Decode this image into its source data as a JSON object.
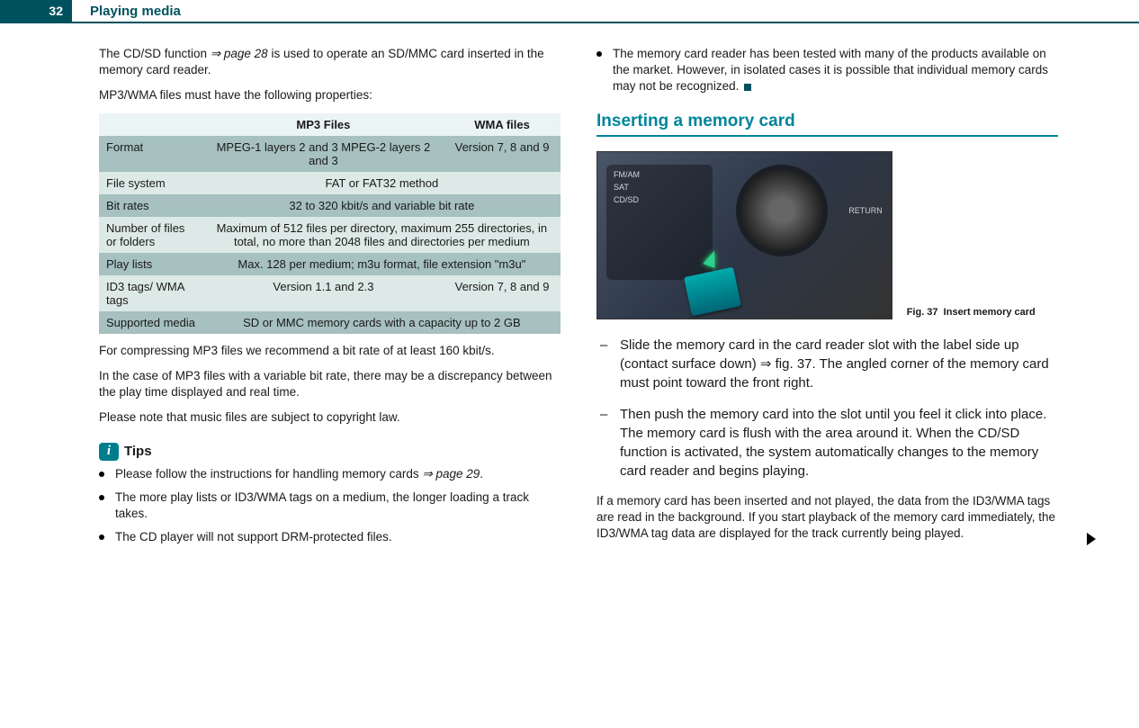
{
  "page_number": "32",
  "chapter": "Playing media",
  "left_col": {
    "intro1_a": "The CD/SD function ",
    "intro1_link": "⇒ page 28",
    "intro1_b": " is used to operate an SD/MMC card inserted in the memory card reader.",
    "intro2": "MP3/WMA files must have the following properties:",
    "table": {
      "header_blank": "",
      "header_mp3": "MP3 Files",
      "header_wma": "WMA files",
      "rows": [
        {
          "label": "Format",
          "mp3": "MPEG-1 layers 2 and 3 MPEG-2 layers 2 and 3",
          "wma": "Version 7, 8 and 9",
          "tone": "dark"
        },
        {
          "label": "File system",
          "span": "FAT or FAT32 method",
          "tone": "light"
        },
        {
          "label": "Bit rates",
          "span": "32 to 320 kbit/s and variable bit rate",
          "tone": "dark"
        },
        {
          "label": "Number of files or folders",
          "span": "Maximum of 512 files per directory, maximum 255 directories, in total, no more than 2048 files and directories per medium",
          "tone": "light"
        },
        {
          "label": "Play lists",
          "span": "Max. 128 per medium; m3u format, file extension \"m3u\"",
          "tone": "dark"
        },
        {
          "label": "ID3 tags/ WMA tags",
          "mp3": "Version 1.1 and 2.3",
          "wma": "Version 7, 8 and 9",
          "tone": "light"
        },
        {
          "label": "Supported media",
          "span": "SD or MMC memory cards with a capacity up to 2 GB",
          "tone": "dark"
        }
      ]
    },
    "after1": "For compressing MP3 files we recommend a bit rate of at least 160 kbit/s.",
    "after2": "In the case of MP3 files with a variable bit rate, there may be a discrepancy between the play time displayed and real time.",
    "after3": "Please note that music files are subject to copyright law.",
    "tips_label": "Tips",
    "tips": [
      {
        "pre": "Please follow the instructions for handling memory cards ",
        "link": "⇒ page 29",
        "post": "."
      },
      {
        "pre": "The more play lists or ID3/WMA tags on a medium, the longer loading a track takes.",
        "link": "",
        "post": ""
      },
      {
        "pre": "The CD player will not support DRM-protected files.",
        "link": "",
        "post": ""
      }
    ]
  },
  "right_col": {
    "top_bullet": "The memory card reader has been tested with many of the products available on the market. However, in isolated cases it is possible that individual memory cards may not be recognized.",
    "section_title": "Inserting a memory card",
    "fig_caption_a": "Fig. 37",
    "fig_caption_b": "Insert memory card",
    "fig_panel": {
      "a": "FM/AM",
      "b": "SAT",
      "c": "CD/SD"
    },
    "fig_return": "RETURN",
    "steps": [
      "Slide the memory card in the card reader slot with the label side up (contact surface down) ⇒ fig. 37. The angled corner of the memory card must point toward the front right.",
      "Then push the memory card into the slot until you feel it click into place. The memory card is flush with the area around it. When the CD/SD function is activated, the system automatically changes to the memory card reader and begins playing."
    ],
    "closing": "If a memory card has been inserted and not played, the data from the ID3/WMA tags are read in the background. If you start playback of the memory card immediately, the ID3/WMA tag data are displayed for the track currently being played."
  }
}
